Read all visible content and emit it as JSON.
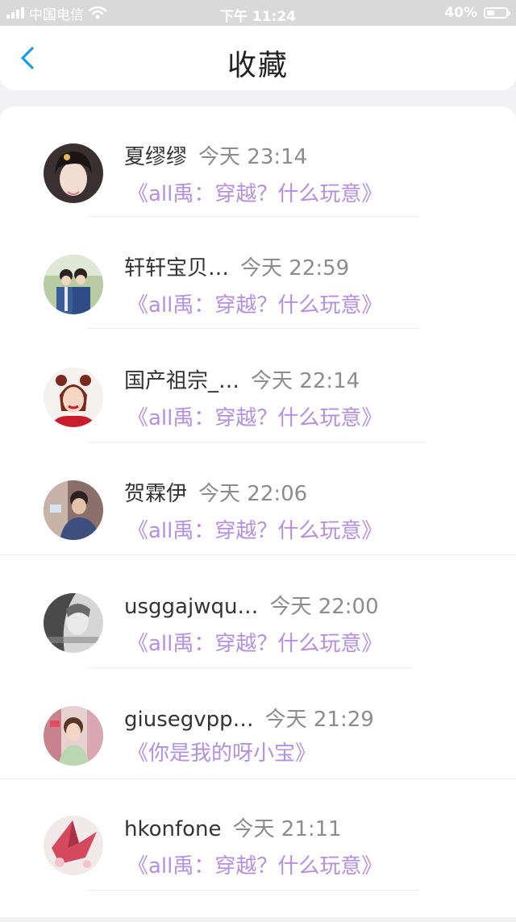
{
  "status_bar": {
    "carrier": "中国电信",
    "time": "下午 11:24",
    "battery": "40%",
    "battery_level": 0.4
  },
  "header": {
    "title": "收藏",
    "back_icon": "chevron-left-icon"
  },
  "colors": {
    "accent": "#1a9be6",
    "work_title": "#b58fe0",
    "timestamp": "#8c8c8c"
  },
  "items": [
    {
      "name": "夏缪缪",
      "time": "今天 23:14",
      "work": "《all禹：穿越？什么玩意》"
    },
    {
      "name": "轩轩宝贝…",
      "time": "今天 22:59",
      "work": "《all禹：穿越？什么玩意》"
    },
    {
      "name": "国产祖宗_…",
      "time": "今天 22:14",
      "work": "《all禹：穿越？什么玩意》"
    },
    {
      "name": "贺霖伊",
      "time": "今天 22:06",
      "work": "《all禹：穿越？什么玩意》"
    },
    {
      "name": "usggajwqu…",
      "time": "今天 22:00",
      "work": "《all禹：穿越？什么玩意》"
    },
    {
      "name": "giusegvpp…",
      "time": "今天 21:29",
      "work": "《你是我的呀小宝》"
    },
    {
      "name": "hkonfone",
      "time": "今天 21:11",
      "work": "《all禹：穿越？什么玩意》"
    }
  ]
}
